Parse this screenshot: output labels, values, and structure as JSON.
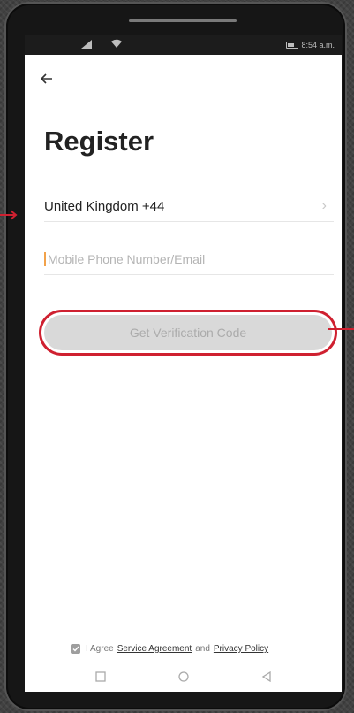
{
  "statusbar": {
    "time": "8:54 a.m."
  },
  "screen": {
    "title": "Register",
    "country": {
      "label": "United Kingdom +44"
    },
    "phone_input": {
      "placeholder": "Mobile Phone Number/Email",
      "value": ""
    },
    "verify_button": {
      "label": "Get Verification Code"
    },
    "agreement": {
      "prefix": "I Agree",
      "service_link": "Service Agreement",
      "and": "and",
      "privacy_link": "Privacy Policy"
    }
  },
  "colors": {
    "callout": "#cf2030",
    "button_bg": "#d9d9d9",
    "cursor": "#f2a24a"
  },
  "icons": {
    "back": "arrow-left-icon",
    "chevron": "chevron-right-icon",
    "nav_recent": "square-icon",
    "nav_home": "circle-icon",
    "nav_back": "triangle-left-icon"
  }
}
